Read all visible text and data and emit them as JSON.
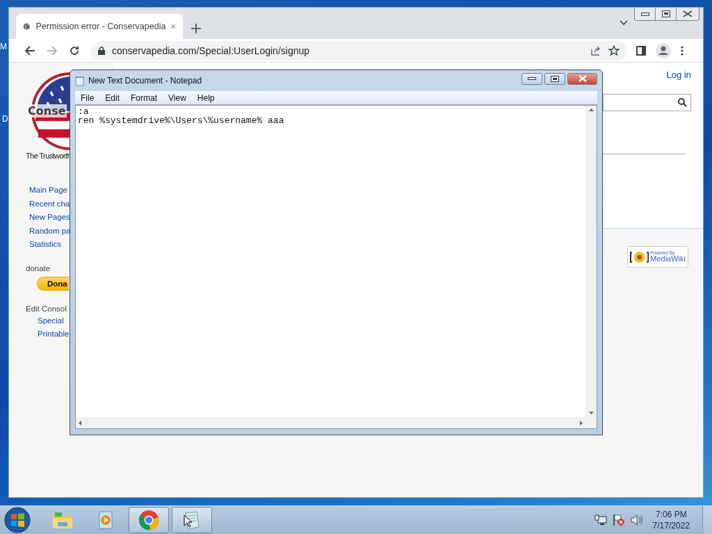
{
  "desktop": {
    "icon_labels": [
      "M",
      "D"
    ]
  },
  "browser": {
    "tabs": [
      {
        "title": "Permission error - Conservapedia",
        "selected": true
      }
    ],
    "address": "conservapedia.com/Special:UserLogin/signup",
    "page": {
      "logo_text": "Conse",
      "tagline": "The Trustworth",
      "nav": [
        "Main Page",
        "Recent cha",
        "New Pages",
        "Random pa",
        "Statistics"
      ],
      "donate_heading": "donate",
      "donate_button": "Dona",
      "tools_heading": "Edit Consol",
      "tools": [
        "Special",
        "Printable"
      ],
      "login": "Log in",
      "badge": {
        "line_1": "Powered By",
        "line_2": "MediaWiki"
      }
    }
  },
  "notepad": {
    "title": "New Text Document - Notepad",
    "menu": [
      "File",
      "Edit",
      "Format",
      "View",
      "Help"
    ],
    "lines": [
      ":a",
      "ren %systemdrive%\\Users\\%username% aaa"
    ]
  },
  "taskbar": {
    "apps": [
      {
        "kind": "explorer",
        "running": false
      },
      {
        "kind": "media",
        "running": false
      },
      {
        "kind": "chrome",
        "running": true
      },
      {
        "kind": "notepad",
        "running": true
      }
    ],
    "clock": {
      "time": "7:06 PM",
      "date": "7/17/2022"
    }
  }
}
